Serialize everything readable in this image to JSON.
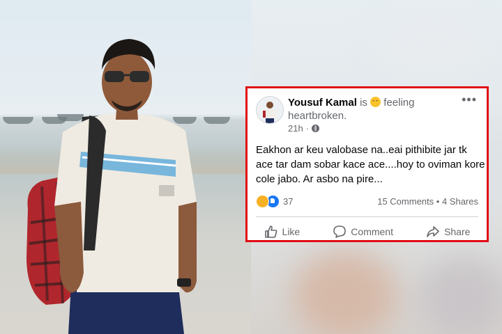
{
  "post": {
    "author": "Yousuf Kamal",
    "is_word": "is",
    "feeling_word": "feeling",
    "feeling_value": "heartbroken.",
    "time": "21h",
    "dot": "·",
    "more": "•••",
    "text": "Eakhon ar keu valobase na..eai pithibite jar tk ace tar dam sobar kace ace....hoy to oviman kore cole jabo. Ar asbo na pire...",
    "reaction_count": "37",
    "comments": "15 Comments",
    "shares": "4 Shares",
    "separator": "•",
    "actions": {
      "like": "Like",
      "comment": "Comment",
      "share": "Share"
    }
  },
  "colors": {
    "frame": "#e10c14",
    "like_blue": "#1877f2",
    "muted": "#65676b"
  },
  "icons": [
    "emoji-sad-icon",
    "globe-icon",
    "more-options-icon",
    "sad-reaction-icon",
    "like-reaction-icon",
    "like-icon",
    "comment-icon",
    "share-icon"
  ]
}
